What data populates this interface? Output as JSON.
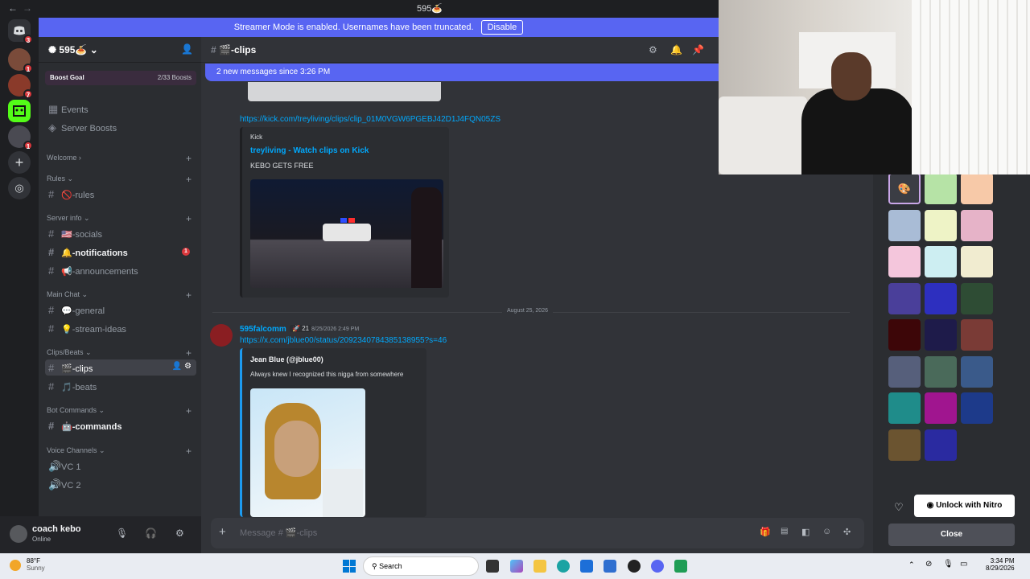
{
  "window": {
    "title": "595🍝"
  },
  "banner": {
    "text": "Streamer Mode is enabled. Usernames have been truncated.",
    "disable_label": "Disable"
  },
  "rail": {
    "badges": [
      "3",
      "1",
      "7",
      "1"
    ]
  },
  "sidebar": {
    "server_name": "595🍝",
    "boost_goal": "Boost Goal",
    "boost_count": "2/33 Boosts",
    "top_items": [
      "Events",
      "Server Boosts"
    ],
    "categories": {
      "welcome": "Welcome",
      "rules": "Rules",
      "server_info": "Server info",
      "main_chat": "Main Chat",
      "clips_beats": "Clips/Beats",
      "bot_commands": "Bot Commands",
      "voice_channels": "Voice Channels"
    },
    "channels": {
      "rules": "🚫-rules",
      "socials": "🇺🇸-socials",
      "notifications": "🔔-notifications",
      "notifications_badge": "1",
      "announcements": "📢-announcements",
      "general": "💬-general",
      "stream_ideas": "💡-stream-ideas",
      "clips": "🎬-clips",
      "beats": "🎵-beats",
      "commands": "🤖-commands",
      "vc1": "VC 1",
      "vc2": "VC 2"
    }
  },
  "user": {
    "name": "coach kebo",
    "status": "Online"
  },
  "chat": {
    "channel": "🎬-clips",
    "new_messages": "2 new messages since 3:26 PM",
    "link1": "https://kick.com/treyliving/clips/clip_01M0VGW6PGEBJ42D1J4FQN05ZS",
    "embed1_provider": "Kick",
    "embed1_title": "treyliving - Watch clips on Kick",
    "embed1_desc": "KEBO GETS FREE",
    "date_divider": "August 25, 2026",
    "msg2_author": "595falcomm",
    "msg2_badge": "21",
    "msg2_time": "8/25/2026 2:49 PM",
    "link2": "https://x.com/jblue00/status/2092340784385138955?s=46",
    "embed2_title": "Jean Blue (@jblue00)",
    "embed2_desc": "Always knew I recognized this nigga from somewhere",
    "composer_placeholder": "Message # 🎬-clips"
  },
  "right_panel": {
    "unlock_label": "Unlock with Nitro",
    "close_label": "Close",
    "swatches": [
      "#3b3d44",
      "#b6e3a6",
      "#f7c9a8",
      "#a9bcd6",
      "#eef3c6",
      "#e6b3c8",
      "#f4c6dc",
      "#cdeef2",
      "#f1ecd0",
      "#4a3f9a",
      "#2d2fbf",
      "#2e4c34",
      "#3d0608",
      "#1e1b4a",
      "#7a3b36",
      "#565f7b",
      "#4a6a5a",
      "#3a5a8a",
      "#1f8c8a",
      "#a0158f",
      "#1d3a8a",
      "#6b5430",
      "#2a2aa0"
    ]
  },
  "taskbar": {
    "temp": "88°F",
    "weather": "Sunny",
    "search": "Search",
    "time": "3:34 PM",
    "date": "8/29/2026"
  }
}
